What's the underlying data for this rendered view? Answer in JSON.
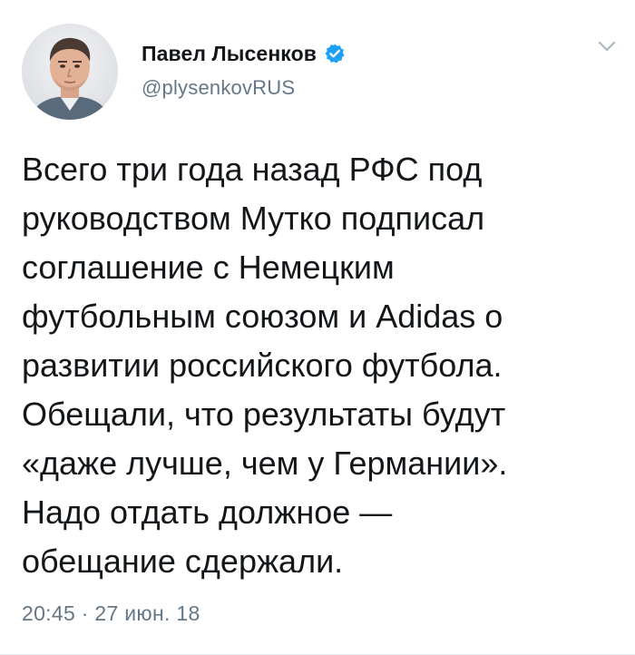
{
  "author": {
    "display_name": "Павел Лысенков",
    "handle": "@plysenkovRUS",
    "verified": true,
    "verified_icon": "verified-badge-icon",
    "verified_color": "#1da1f2"
  },
  "menu": {
    "icon": "chevron-down-icon"
  },
  "tweet": {
    "lines": [
      "Всего три года назад РФС под",
      "руководством Мутко подписал",
      "соглашение с Немецким",
      "футбольным союзом и Adidas о",
      "развитии российского футбола.",
      "Обещали, что результаты будут",
      "«даже лучше, чем у Германии».",
      "Надо отдать должное —",
      "обещание сдержали."
    ],
    "timestamp": "20:45 · 27 июн. 18"
  },
  "colors": {
    "text": "#14171a",
    "secondary": "#657786",
    "accent": "#1da1f2"
  }
}
